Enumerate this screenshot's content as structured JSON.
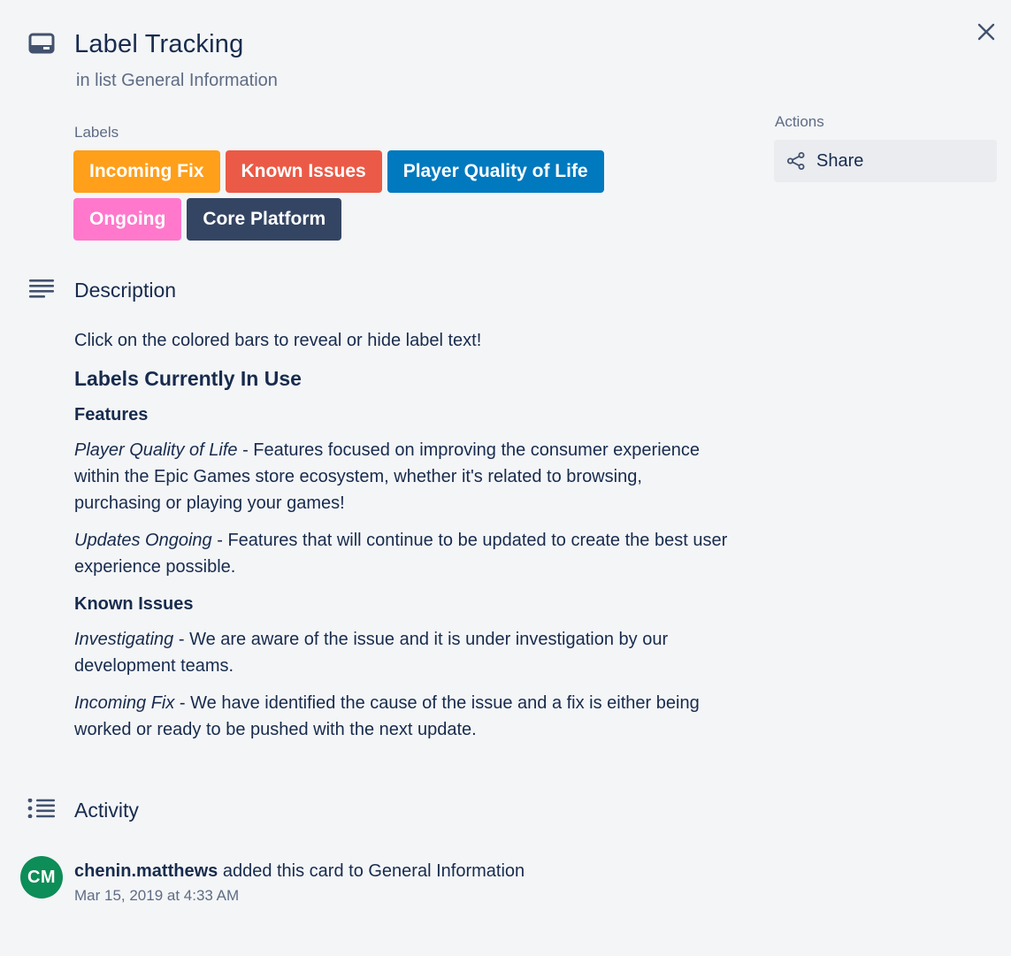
{
  "card": {
    "title": "Label Tracking",
    "subtitle_prefix": "in list",
    "list_name": "General Information"
  },
  "labels": {
    "heading": "Labels",
    "items": [
      {
        "text": "Incoming Fix",
        "color": "#ff9f1a"
      },
      {
        "text": "Known Issues",
        "color": "#eb5a46"
      },
      {
        "text": "Player Quality of Life",
        "color": "#0079bf"
      },
      {
        "text": "Ongoing",
        "color": "#ff78cb"
      },
      {
        "text": "Core Platform",
        "color": "#344563"
      }
    ]
  },
  "actions": {
    "heading": "Actions",
    "share_label": "Share"
  },
  "description": {
    "heading": "Description",
    "intro": "Click on the colored bars to reveal or hide label text!",
    "section_title": "Labels Currently In Use",
    "groups": [
      {
        "title": "Features",
        "entries": [
          {
            "term": "Player Quality of Life",
            "text": " - Features focused on improving the consumer experience within the Epic Games store ecosystem, whether it's related to browsing, purchasing or playing your games!"
          },
          {
            "term": "Updates Ongoing",
            "text": " - Features that will continue to be updated to create the best user experience possible."
          }
        ]
      },
      {
        "title": "Known Issues",
        "entries": [
          {
            "term": "Investigating",
            "text": " - We are aware of the issue and it is under investigation by our development teams."
          },
          {
            "term": "Incoming Fix",
            "text": " - We have identified the cause of the issue and a fix is either being worked or ready to be pushed with the next update."
          }
        ]
      }
    ]
  },
  "activity": {
    "heading": "Activity",
    "items": [
      {
        "avatar_initials": "CM",
        "avatar_color": "#0d8d57",
        "member": "chenin.matthews",
        "action": " added this card to General Information",
        "time": "Mar 15, 2019 at 4:33 AM"
      }
    ]
  }
}
